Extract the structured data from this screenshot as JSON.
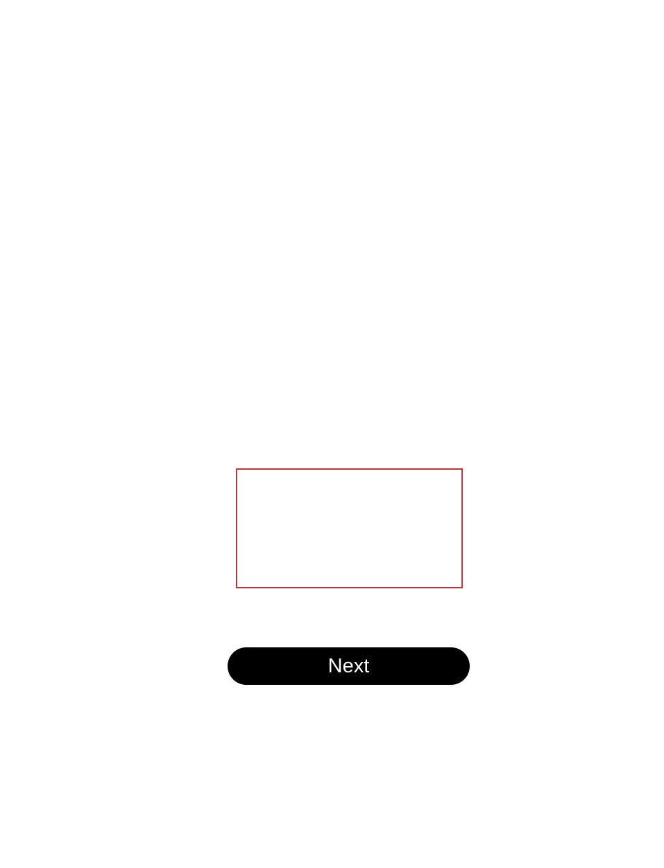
{
  "form": {
    "input_value": "",
    "input_border_color": "#b33a3a"
  },
  "actions": {
    "next_label": "Next"
  }
}
